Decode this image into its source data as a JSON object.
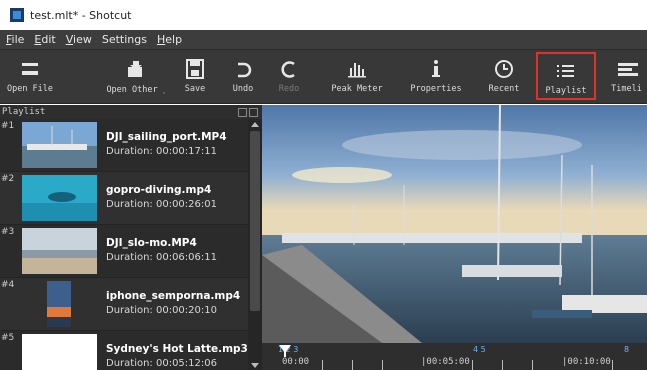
{
  "window": {
    "title": "test.mlt* - Shotcut"
  },
  "menu": [
    {
      "label": "File"
    },
    {
      "label": "Edit"
    },
    {
      "label": "View"
    },
    {
      "label": "Settings"
    },
    {
      "label": "Help"
    }
  ],
  "toolbar": {
    "open_file": "Open File",
    "open_other": "Open Other ˯",
    "save": "Save",
    "undo": "Undo",
    "redo": "Redo",
    "peak_meter": "Peak Meter",
    "properties": "Properties",
    "recent": "Recent",
    "playlist": "Playlist",
    "timeline": "Timeli"
  },
  "playlist": {
    "title": "Playlist",
    "items": [
      {
        "num": "#1",
        "name": "DJI_sailing_port.MP4",
        "duration": "Duration: 00:00:17:11"
      },
      {
        "num": "#2",
        "name": "gopro-diving.mp4",
        "duration": "Duration: 00:00:26:01"
      },
      {
        "num": "#3",
        "name": "DJI_slo-mo.MP4",
        "duration": "Duration: 00:06:06:11"
      },
      {
        "num": "#4",
        "name": "iphone_semporna.mp4",
        "duration": "Duration: 00:00:20:10"
      },
      {
        "num": "#5",
        "name": "Sydney's Hot Latte.mp3",
        "duration": "Duration: 00:05:12:06"
      }
    ]
  },
  "timeline": {
    "labels": [
      "00:00",
      "|00:05:00",
      "|00:10:00"
    ],
    "markers": [
      "1 2 3",
      "4 5",
      "8"
    ]
  },
  "colors": {
    "highlight": "#e0322b",
    "marker": "#6fb3ff"
  }
}
